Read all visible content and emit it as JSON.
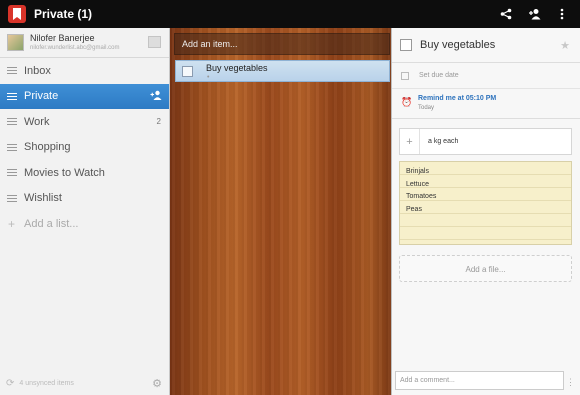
{
  "topbar": {
    "title": "Private (1)",
    "actions": [
      "share-icon",
      "add-person-icon",
      "overflow-menu-icon"
    ]
  },
  "profile": {
    "name": "Nilofer Banerjee",
    "email": "nilofer.wunderlist.abc@gmail.com"
  },
  "lists": [
    {
      "label": "Inbox",
      "count": ""
    },
    {
      "label": "Private",
      "count": "",
      "active": true
    },
    {
      "label": "Work",
      "count": "2"
    },
    {
      "label": "Shopping",
      "count": ""
    },
    {
      "label": "Movies to Watch",
      "count": ""
    },
    {
      "label": "Wishlist",
      "count": ""
    }
  ],
  "add_list_label": "Add a list...",
  "sidebar_footer": {
    "sync_text": "4 unsynced items"
  },
  "main": {
    "add_item_placeholder": "Add an item...",
    "tasks": [
      {
        "title": "Buy vegetables",
        "subtitle": "•"
      }
    ]
  },
  "detail": {
    "title": "Buy vegetables",
    "due_date_label": "Set due date",
    "reminder_label": "Remind me at 05:10 PM",
    "reminder_sub": "Today",
    "subtask": "a kg each",
    "note_lines": [
      "Brinjals",
      "Lettuce",
      "Tomatoes",
      "Peas"
    ],
    "add_file_label": "Add a file...",
    "comment_placeholder": "Add a comment..."
  },
  "colors": {
    "accent": "#2d7bc4",
    "topbar": "#0d0d0d",
    "note_bg": "#f7f0cb"
  }
}
